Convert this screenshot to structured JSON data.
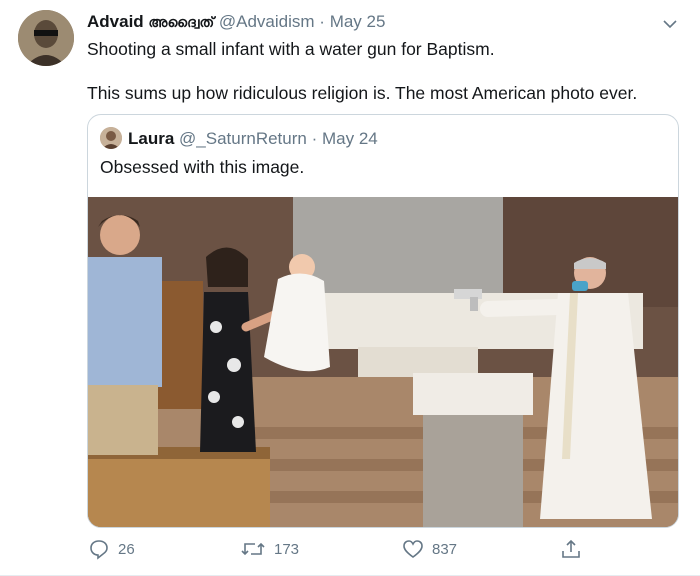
{
  "tweet": {
    "author_name": "Advaid",
    "author_name_alt": "അദ്വൈത്",
    "handle": "@Advaidism",
    "separator": "·",
    "date": "May 25",
    "text_line1": "Shooting a small infant with a water gun for Baptism.",
    "text_line2": "This sums up how ridiculous religion is. The most American photo ever."
  },
  "quoted": {
    "author_name": "Laura",
    "handle": "@_SaturnReturn",
    "separator": "·",
    "date": "May 24",
    "text": "Obsessed with this image."
  },
  "actions": {
    "replies": "26",
    "retweets": "173",
    "likes": "837"
  },
  "icons": [
    "chevron-down-icon",
    "reply-icon",
    "retweet-icon",
    "like-icon",
    "share-icon"
  ],
  "colors": {
    "secondary_text": "#657786",
    "border": "#ccd6dd"
  }
}
